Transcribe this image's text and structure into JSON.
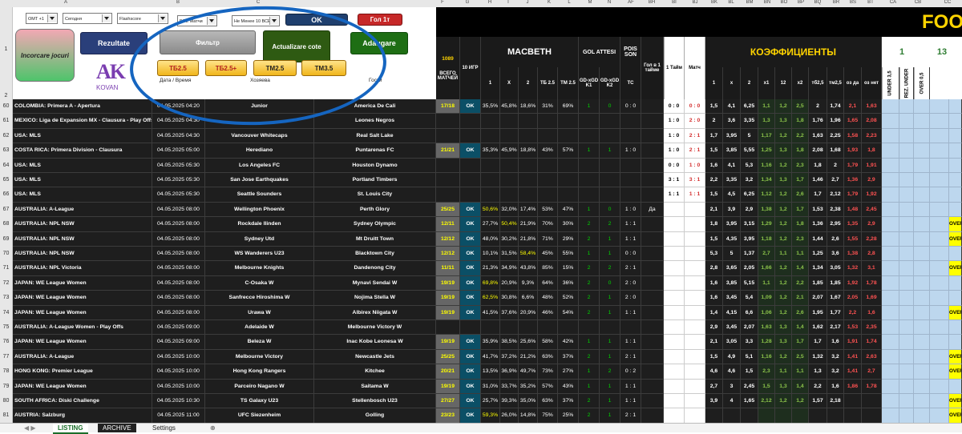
{
  "colors": {
    "yellow": "#ffff00",
    "ok_bg": "#0b4f66",
    "green": "#00d400",
    "red_text": "#ff4c4c",
    "light_blue": "#bdd7ee",
    "over_bg": "#ffff00"
  },
  "column_letters": [
    "A",
    "B",
    "C",
    "F",
    "G",
    "H",
    "I",
    "J",
    "K",
    "L",
    "M",
    "N",
    "AF",
    "BH",
    "BI",
    "BJ",
    "BK",
    "BL",
    "BM",
    "BN",
    "BO",
    "BP",
    "BQ",
    "BR",
    "BS",
    "BT",
    "CA",
    "CB",
    "CC"
  ],
  "selects": [
    {
      "value": "OMT +1"
    },
    {
      "value": "Сегодня"
    },
    {
      "value": "Flashscore"
    },
    {
      "value": "ВСЕ Матчи"
    },
    {
      "value": "Не Менее 10 ВСЕХ"
    }
  ],
  "buttons": {
    "incorcare": "Incorcare jocuri",
    "rezultate": "Rezultate",
    "filter": "Фильтр",
    "actualizare": "Actualizare cote",
    "adaugare": "Adaugare",
    "ok": "OK",
    "gol": "Гол 1т",
    "tb25": "ТБ2.5",
    "tb25p": "ТБ2.5+",
    "tm25": "ТМ2.5",
    "tm35": "ТМ3.5"
  },
  "logo": {
    "letters": "AK",
    "text": "KOVAN"
  },
  "labels": {
    "date_time": "Дата / Время",
    "home": "Хозяева",
    "away": "Гости",
    "count": "1089",
    "title_partial": "FOO"
  },
  "headers": {
    "total": "ВСЕГО МАТЧЕЙ",
    "last10": "10 ИГР",
    "macbeth": "MACBETH",
    "h1": "1",
    "hx": "X",
    "h2": "2",
    "tb": "ТБ 2.5",
    "tm": "ТМ 2.5",
    "gol_attesi": "GOL ATTESI",
    "gdx1": "GD-xGD K1",
    "gdx2": "GD-xGD K2",
    "poisson": "POIS SON",
    "tc": "TC",
    "gol1": "Гол в 1 тайме",
    "t1": "1 Тайм",
    "match": "Матч",
    "coef": "КОЭФФИЦИЕНТЫ",
    "k1": "1",
    "kx": "x",
    "k2": "2",
    "kx1": "x1",
    "k12": "12",
    "kx2": "x2",
    "ktb": "тб2,5",
    "ktm": "тм2,5",
    "koz": "оз да",
    "kozn": "оз нет",
    "under": "UNDER 3,5",
    "rez": "REZ. UNDER",
    "over": "OVER 0,5",
    "n1": "1",
    "n13": "13"
  },
  "rows": [
    {
      "n": "60",
      "league": "COLOMBIA: Primera A - Apertura",
      "dt": "04.05.2025 04:20",
      "home": "Junior",
      "away": "America De Cali",
      "tot": "17/18",
      "ok": "OK",
      "p1": "35,5%",
      "px": "45,8%",
      "p2": "18,6%",
      "tb": "31%",
      "tm": "69%",
      "g1": "1",
      "g2": "0",
      "tc": "0 : 0",
      "gl": "",
      "ht": "0 : 0",
      "ft": "0 : 0",
      "k": [
        "1,5",
        "4,1",
        "6,25",
        "1,1",
        "1,2",
        "2,5",
        "2",
        "1,74",
        "2,1",
        "1,63"
      ],
      "over": ""
    },
    {
      "n": "61",
      "league": "MEXICO: Liga de Expansion MX - Clausura - Play Offs",
      "dt": "04.05.2025 04:30",
      "home": "",
      "away": "Leones Negros",
      "tot": "",
      "ok": "",
      "p1": "",
      "px": "",
      "p2": "",
      "tb": "",
      "tm": "",
      "g1": "",
      "g2": "",
      "tc": "",
      "gl": "",
      "ht": "1 : 0",
      "ft": "2 : 0",
      "k": [
        "2",
        "3,6",
        "3,35",
        "1,3",
        "1,3",
        "1,8",
        "1,76",
        "1,96",
        "1,65",
        "2,08"
      ],
      "over": ""
    },
    {
      "n": "62",
      "league": "USA: MLS",
      "dt": "04.05.2025 04:30",
      "home": "Vancouver Whitecaps",
      "away": "Real Salt Lake",
      "tot": "",
      "ok": "",
      "p1": "",
      "px": "",
      "p2": "",
      "tb": "",
      "tm": "",
      "g1": "",
      "g2": "",
      "tc": "",
      "gl": "",
      "ht": "1 : 0",
      "ft": "2 : 1",
      "k": [
        "1,7",
        "3,95",
        "5",
        "1,17",
        "1,2",
        "2,2",
        "1,63",
        "2,25",
        "1,58",
        "2,23"
      ],
      "over": ""
    },
    {
      "n": "63",
      "league": "COSTA RICA: Primera Division - Clausura",
      "dt": "04.05.2025 05:00",
      "home": "Herediano",
      "away": "Puntarenas FC",
      "tot": "21/21",
      "ok": "OK",
      "p1": "35,3%",
      "px": "45,9%",
      "p2": "18,8%",
      "tb": "43%",
      "tm": "57%",
      "g1": "1",
      "g2": "1",
      "tc": "1 : 0",
      "gl": "",
      "ht": "1 : 0",
      "ft": "2 : 1",
      "k": [
        "1,5",
        "3,85",
        "5,55",
        "1,25",
        "1,3",
        "1,8",
        "2,08",
        "1,68",
        "1,93",
        "1,8"
      ],
      "over": ""
    },
    {
      "n": "64",
      "league": "USA: MLS",
      "dt": "04.05.2025 05:30",
      "home": "Los Angeles FC",
      "away": "Houston Dynamo",
      "tot": "",
      "ok": "",
      "p1": "",
      "px": "",
      "p2": "",
      "tb": "",
      "tm": "",
      "g1": "",
      "g2": "",
      "tc": "",
      "gl": "",
      "ht": "0 : 0",
      "ft": "1 : 0",
      "k": [
        "1,6",
        "4,1",
        "5,3",
        "1,16",
        "1,2",
        "2,3",
        "1,8",
        "2",
        "1,79",
        "1,91"
      ],
      "over": ""
    },
    {
      "n": "65",
      "league": "USA: MLS",
      "dt": "04.05.2025 05:30",
      "home": "San Jose Earthquakes",
      "away": "Portland Timbers",
      "tot": "",
      "ok": "",
      "p1": "",
      "px": "",
      "p2": "",
      "tb": "",
      "tm": "",
      "g1": "",
      "g2": "",
      "tc": "",
      "gl": "",
      "ht": "3 : 1",
      "ft": "3 : 1",
      "k": [
        "2,2",
        "3,35",
        "3,2",
        "1,34",
        "1,3",
        "1,7",
        "1,46",
        "2,7",
        "1,36",
        "2,9"
      ],
      "over": ""
    },
    {
      "n": "66",
      "league": "USA: MLS",
      "dt": "04.05.2025 05:30",
      "home": "Seattle Sounders",
      "away": "St. Louis City",
      "tot": "",
      "ok": "",
      "p1": "",
      "px": "",
      "p2": "",
      "tb": "",
      "tm": "",
      "g1": "",
      "g2": "",
      "tc": "",
      "gl": "",
      "ht": "1 : 1",
      "ft": "1 : 1",
      "k": [
        "1,5",
        "4,5",
        "6,25",
        "1,12",
        "1,2",
        "2,6",
        "1,7",
        "2,12",
        "1,79",
        "1,92"
      ],
      "over": ""
    },
    {
      "n": "67",
      "league": "AUSTRALIA: A-League",
      "dt": "04.05.2025 08:00",
      "home": "Wellington Phoenix",
      "away": "Perth Glory",
      "tot": "25/25",
      "ok": "OK",
      "p1": "50,6%",
      "px": "32,0%",
      "p2": "17,4%",
      "tb": "53%",
      "tm": "47%",
      "g1": "1",
      "g2": "0",
      "tc": "1 : 0",
      "gl": "Да",
      "ht": "",
      "ft": "",
      "k": [
        "2,1",
        "3,9",
        "2,9",
        "1,38",
        "1,2",
        "1,7",
        "1,53",
        "2,38",
        "1,48",
        "2,45"
      ],
      "over": ""
    },
    {
      "n": "68",
      "league": "AUSTRALIA: NPL NSW",
      "dt": "04.05.2025 08:00",
      "home": "Rockdale Ilinden",
      "away": "Sydney Olympic",
      "tot": "12/11",
      "ok": "OK",
      "p1": "27,7%",
      "px": "50,4%",
      "p2": "21,9%",
      "tb": "70%",
      "tm": "30%",
      "g1": "2",
      "g2": "2",
      "tc": "1 : 1",
      "gl": "",
      "ht": "",
      "ft": "",
      "k": [
        "1,8",
        "3,95",
        "3,15",
        "1,29",
        "1,2",
        "1,8",
        "1,36",
        "2,95",
        "1,35",
        "2,9"
      ],
      "over": "OVER 0,5"
    },
    {
      "n": "69",
      "league": "AUSTRALIA: NPL NSW",
      "dt": "04.05.2025 08:00",
      "home": "Sydney Utd",
      "away": "Mt Druitt Town",
      "tot": "12/12",
      "ok": "OK",
      "p1": "48,0%",
      "px": "30,2%",
      "p2": "21,8%",
      "tb": "71%",
      "tm": "29%",
      "g1": "2",
      "g2": "1",
      "tc": "1 : 1",
      "gl": "",
      "ht": "",
      "ft": "",
      "k": [
        "1,5",
        "4,35",
        "3,95",
        "1,18",
        "1,2",
        "2,3",
        "1,44",
        "2,6",
        "1,55",
        "2,28"
      ],
      "over": "OVER 0,5"
    },
    {
      "n": "70",
      "league": "AUSTRALIA: NPL NSW",
      "dt": "04.05.2025 08:00",
      "home": "WS Wanderers U23",
      "away": "Blacktown City",
      "tot": "12/12",
      "ok": "OK",
      "p1": "10,1%",
      "px": "31,5%",
      "p2": "58,4%",
      "tb": "45%",
      "tm": "55%",
      "g1": "1",
      "g2": "1",
      "tc": "0 : 0",
      "gl": "",
      "ht": "",
      "ft": "",
      "k": [
        "5,3",
        "5",
        "1,37",
        "2,7",
        "1,1",
        "1,1",
        "1,25",
        "3,6",
        "1,38",
        "2,8"
      ],
      "over": ""
    },
    {
      "n": "71",
      "league": "AUSTRALIA: NPL Victoria",
      "dt": "04.05.2025 08:00",
      "home": "Melbourne Knights",
      "away": "Dandenong City",
      "tot": "11/11",
      "ok": "OK",
      "p1": "21,3%",
      "px": "34,9%",
      "p2": "43,8%",
      "tb": "85%",
      "tm": "15%",
      "g1": "2",
      "g2": "2",
      "tc": "2 : 1",
      "gl": "",
      "ht": "",
      "ft": "",
      "k": [
        "2,8",
        "3,65",
        "2,05",
        "1,66",
        "1,2",
        "1,4",
        "1,34",
        "3,05",
        "1,32",
        "3,1"
      ],
      "over": "OVER 0,5"
    },
    {
      "n": "72",
      "league": "JAPAN: WE League Women",
      "dt": "04.05.2025 08:00",
      "home": "C-Osaka W",
      "away": "Mynavi Sendai W",
      "tot": "19/19",
      "ok": "OK",
      "p1": "69,8%",
      "px": "20,9%",
      "p2": "9,3%",
      "tb": "64%",
      "tm": "36%",
      "g1": "2",
      "g2": "0",
      "tc": "2 : 0",
      "gl": "",
      "ht": "",
      "ft": "",
      "k": [
        "1,6",
        "3,85",
        "5,15",
        "1,1",
        "1,2",
        "2,2",
        "1,85",
        "1,85",
        "1,92",
        "1,78"
      ],
      "over": ""
    },
    {
      "n": "73",
      "league": "JAPAN: WE League Women",
      "dt": "04.05.2025 08:00",
      "home": "Sanfrecce Hiroshima W",
      "away": "Nojima Stella W",
      "tot": "19/19",
      "ok": "OK",
      "p1": "62,5%",
      "px": "30,8%",
      "p2": "6,6%",
      "tb": "48%",
      "tm": "52%",
      "g1": "2",
      "g2": "1",
      "tc": "2 : 0",
      "gl": "",
      "ht": "",
      "ft": "",
      "k": [
        "1,6",
        "3,45",
        "5,4",
        "1,09",
        "1,2",
        "2,1",
        "2,07",
        "1,67",
        "2,05",
        "1,69"
      ],
      "over": ""
    },
    {
      "n": "74",
      "league": "JAPAN: WE League Women",
      "dt": "04.05.2025 08:00",
      "home": "Urawa W",
      "away": "Albirex Niigata W",
      "tot": "19/19",
      "ok": "OK",
      "p1": "41,5%",
      "px": "37,6%",
      "p2": "20,9%",
      "tb": "46%",
      "tm": "54%",
      "g1": "2",
      "g2": "1",
      "tc": "1 : 1",
      "gl": "",
      "ht": "",
      "ft": "",
      "k": [
        "1,4",
        "4,15",
        "6,6",
        "1,06",
        "1,2",
        "2,6",
        "1,95",
        "1,77",
        "2,2",
        "1,6"
      ],
      "over": "OVER 0,5"
    },
    {
      "n": "75",
      "league": "AUSTRALIA: A-League Women - Play Offs",
      "dt": "04.05.2025 09:00",
      "home": "Adelaide W",
      "away": "Melbourne Victory W",
      "tot": "",
      "ok": "",
      "p1": "",
      "px": "",
      "p2": "",
      "tb": "",
      "tm": "",
      "g1": "",
      "g2": "",
      "tc": "",
      "gl": "",
      "ht": "",
      "ft": "",
      "k": [
        "2,9",
        "3,45",
        "2,07",
        "1,63",
        "1,3",
        "1,4",
        "1,62",
        "2,17",
        "1,53",
        "2,35"
      ],
      "over": ""
    },
    {
      "n": "76",
      "league": "JAPAN: WE League Women",
      "dt": "04.05.2025 09:00",
      "home": "Beleza W",
      "away": "Inac Kobe Leonesa W",
      "tot": "19/19",
      "ok": "OK",
      "p1": "35,9%",
      "px": "38,5%",
      "p2": "25,6%",
      "tb": "58%",
      "tm": "42%",
      "g1": "1",
      "g2": "1",
      "tc": "1 : 1",
      "gl": "",
      "ht": "",
      "ft": "",
      "k": [
        "2,1",
        "3,05",
        "3,3",
        "1,28",
        "1,3",
        "1,7",
        "1,7",
        "1,6",
        "1,91",
        "1,74"
      ],
      "over": ""
    },
    {
      "n": "77",
      "league": "AUSTRALIA: A-League",
      "dt": "04.05.2025 10:00",
      "home": "Melbourne Victory",
      "away": "Newcastle Jets",
      "tot": "25/25",
      "ok": "OK",
      "p1": "41,7%",
      "px": "37,2%",
      "p2": "21,2%",
      "tb": "63%",
      "tm": "37%",
      "g1": "2",
      "g2": "1",
      "tc": "2 : 1",
      "gl": "",
      "ht": "",
      "ft": "",
      "k": [
        "1,5",
        "4,9",
        "5,1",
        "1,16",
        "1,2",
        "2,5",
        "1,32",
        "3,2",
        "1,41",
        "2,63"
      ],
      "over": "OVER 0,5"
    },
    {
      "n": "78",
      "league": "HONG KONG: Premier League",
      "dt": "04.05.2025 10:00",
      "home": "Hong Kong Rangers",
      "away": "Kitchee",
      "tot": "20/21",
      "ok": "OK",
      "p1": "13,5%",
      "px": "36,9%",
      "p2": "49,7%",
      "tb": "73%",
      "tm": "27%",
      "g1": "1",
      "g2": "2",
      "tc": "0 : 2",
      "gl": "",
      "ht": "",
      "ft": "",
      "k": [
        "4,6",
        "4,6",
        "1,5",
        "2,3",
        "1,1",
        "1,1",
        "1,3",
        "3,2",
        "1,41",
        "2,7"
      ],
      "over": "OVER 0,5"
    },
    {
      "n": "79",
      "league": "JAPAN: WE League Women",
      "dt": "04.05.2025 10:00",
      "home": "Parceiro Nagano W",
      "away": "Saitama W",
      "tot": "19/19",
      "ok": "OK",
      "p1": "31,0%",
      "px": "33,7%",
      "p2": "35,2%",
      "tb": "57%",
      "tm": "43%",
      "g1": "1",
      "g2": "1",
      "tc": "1 : 1",
      "gl": "",
      "ht": "",
      "ft": "",
      "k": [
        "2,7",
        "3",
        "2,45",
        "1,5",
        "1,3",
        "1,4",
        "2,2",
        "1,6",
        "1,86",
        "1,78"
      ],
      "over": ""
    },
    {
      "n": "80",
      "league": "SOUTH AFRICA: Diski Challenge",
      "dt": "04.05.2025 10:30",
      "home": "TS Galaxy U23",
      "away": "Stellenbosch U23",
      "tot": "27/27",
      "ok": "OK",
      "p1": "25,7%",
      "px": "39,3%",
      "p2": "35,0%",
      "tb": "63%",
      "tm": "37%",
      "g1": "2",
      "g2": "1",
      "tc": "1 : 1",
      "gl": "",
      "ht": "",
      "ft": "",
      "k": [
        "3,9",
        "4",
        "1,65",
        "2,12",
        "1,2",
        "1,2",
        "1,57",
        "2,18",
        "",
        ""
      ],
      "over": "OVER 0,5"
    },
    {
      "n": "81",
      "league": "AUSTRIA: Salzburg",
      "dt": "04.05.2025 11:00",
      "home": "UFC Siezenheim",
      "away": "Golling",
      "tot": "23/23",
      "ok": "OK",
      "p1": "59,3%",
      "px": "26,0%",
      "p2": "14,8%",
      "tb": "75%",
      "tm": "25%",
      "g1": "2",
      "g2": "1",
      "tc": "2 : 1",
      "gl": "",
      "ht": "",
      "ft": "",
      "k": [
        "",
        "",
        "",
        "",
        "",
        "",
        "",
        "",
        "",
        ""
      ],
      "over": "OVER 0,5"
    }
  ],
  "tabs": [
    {
      "label": "LISTING"
    },
    {
      "label": "ARCHIVE"
    },
    {
      "label": "Settings"
    }
  ]
}
